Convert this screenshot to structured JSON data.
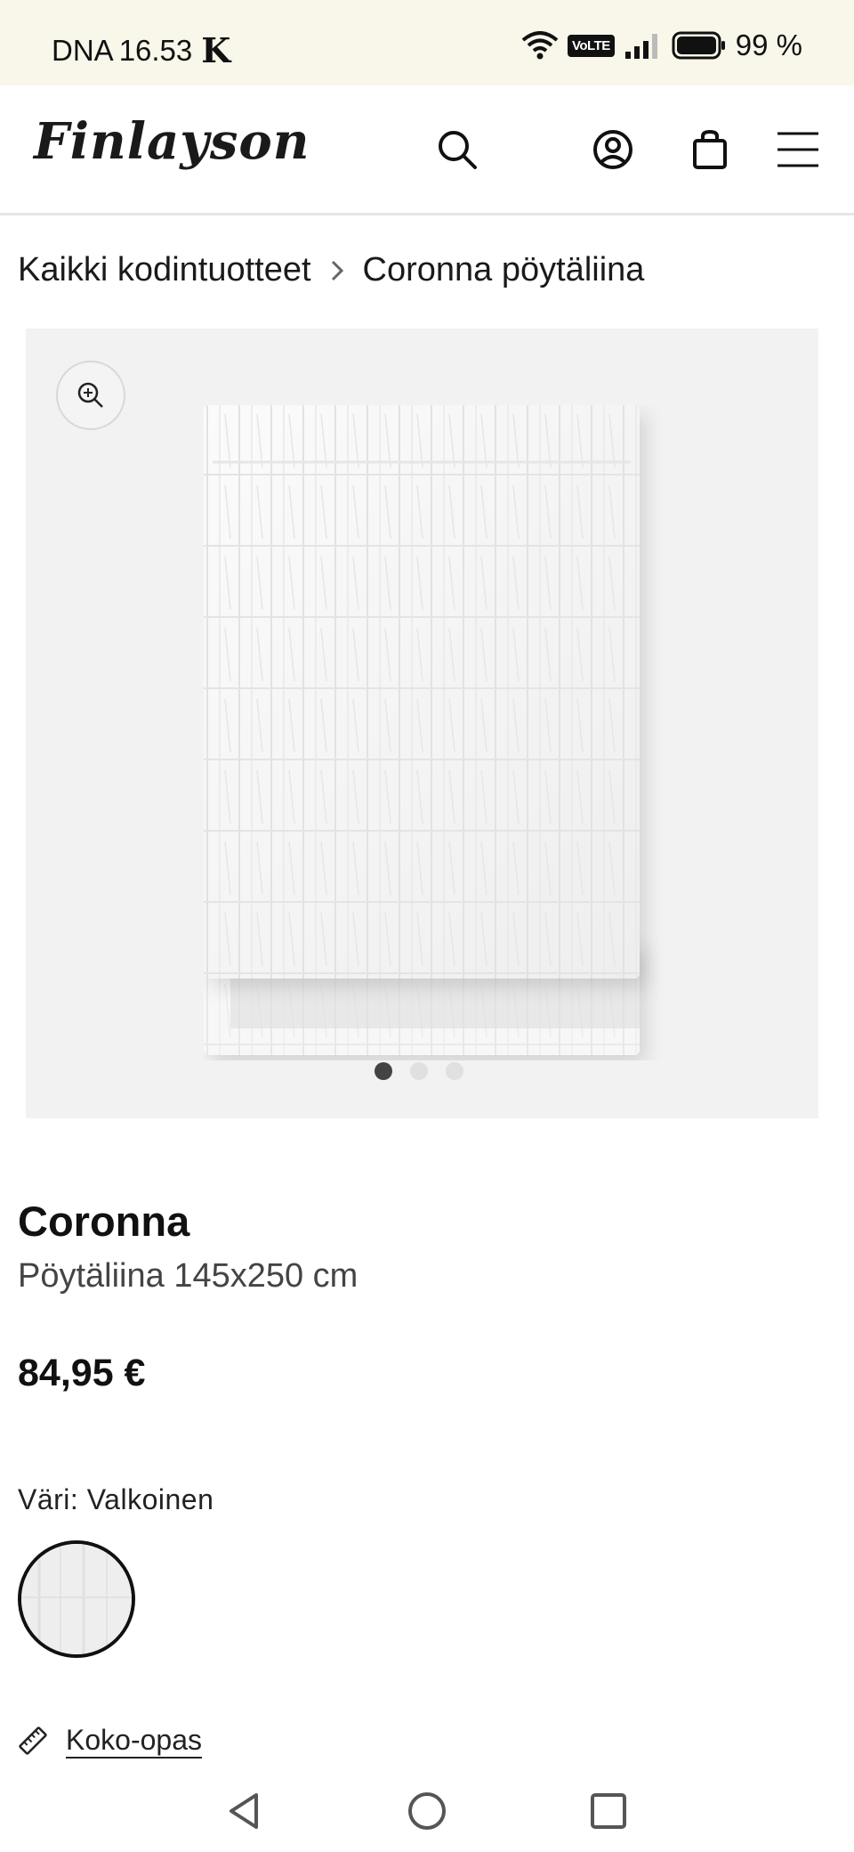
{
  "status_bar": {
    "carrier": "DNA",
    "time": "16.53",
    "k_icon_label": "K",
    "volte": "VoLTE",
    "battery": "99 %"
  },
  "header": {
    "logo": "Finlayson",
    "icons": [
      "search-icon",
      "account-icon",
      "bag-icon",
      "menu-icon"
    ]
  },
  "breadcrumb": {
    "items": [
      "Kaikki kodintuotteet",
      "Coronna pöytäliina"
    ]
  },
  "gallery": {
    "image_count": 3,
    "active_index": 0,
    "background": "#f2f2f2"
  },
  "product": {
    "name": "Coronna",
    "subtitle": "Pöytäliina 145x250 cm",
    "price": "84,95 €",
    "color_label": "Väri: Valkoinen",
    "size_guide": "Koko-opas"
  },
  "nav": {
    "icons": [
      "back-icon",
      "home-icon",
      "recents-icon"
    ]
  }
}
